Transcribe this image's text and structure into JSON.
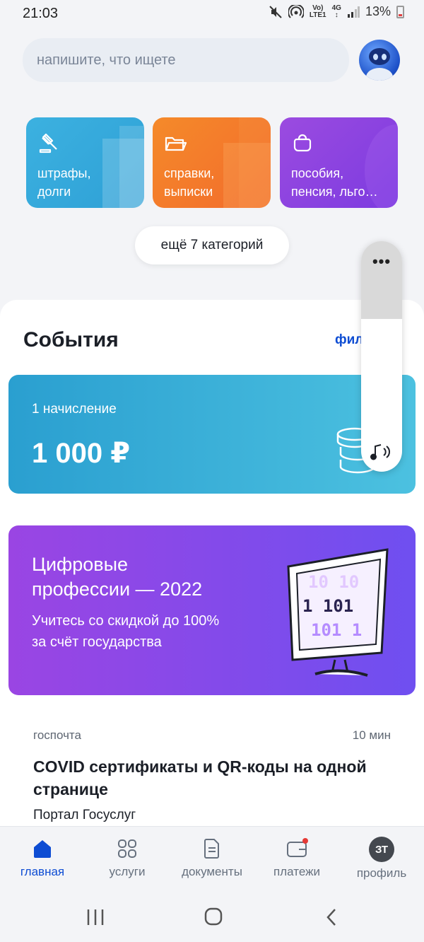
{
  "status_bar": {
    "time": "21:03",
    "network_top": "Vo)",
    "network_bottom": "LTE1",
    "net_gen": "4G",
    "battery": "13%"
  },
  "search": {
    "placeholder": "напишите, что ищете"
  },
  "categories": [
    {
      "label": "штрафы,\nдолги",
      "icon": "gavel-icon",
      "color": "#3cb1e0"
    },
    {
      "label": "справки,\nвыписки",
      "icon": "folder-icon",
      "color": "#f47b2b"
    },
    {
      "label": "пособия,\nпенсия, льго…",
      "icon": "purse-icon",
      "color": "#8c44e3"
    }
  ],
  "more_categories": "ещё 7 категорий",
  "events": {
    "title": "События",
    "filter": "фил"
  },
  "charge_card": {
    "subtitle": "1 начисление",
    "amount": "1 000 ₽"
  },
  "promo": {
    "title": "Цифровые\nпрофессии — 2022",
    "subtitle": "Учитесь со скидкой до 100%\nза счёт государства",
    "screen_digits": [
      "10 10",
      "1 101",
      "101 1"
    ]
  },
  "news": {
    "source": "госпочта",
    "time": "10 мин",
    "title": "COVID сертификаты и QR-коды на одной странице",
    "author": "Портал Госуслуг"
  },
  "widget": {
    "dots": "•••"
  },
  "bottom_nav": [
    {
      "label": "главная",
      "icon": "home-icon",
      "active": true
    },
    {
      "label": "услуги",
      "icon": "grid-icon",
      "active": false
    },
    {
      "label": "документы",
      "icon": "document-icon",
      "active": false
    },
    {
      "label": "платежи",
      "icon": "wallet-icon",
      "active": false
    },
    {
      "label": "профиль",
      "icon": "profile-avatar",
      "active": false,
      "initials": "ЗТ"
    }
  ],
  "colors": {
    "accent": "#0d4cd3",
    "charge_card": "#2ea4d4",
    "promo": "#8a49e8"
  }
}
